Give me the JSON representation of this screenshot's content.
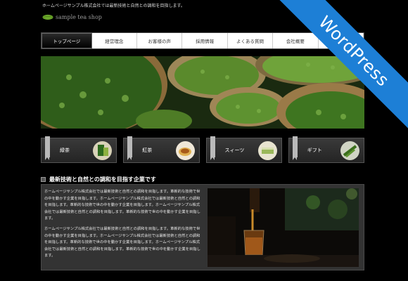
{
  "header": {
    "tagline": "ホームページサンプル株式会社では最新技術と自然との調和を目指します。",
    "logo_text": "sample tea shop"
  },
  "nav": {
    "items": [
      "トップページ",
      "経営理念",
      "お客様の声",
      "採用情報",
      "よくある質問",
      "会社概要",
      "お問"
    ],
    "active_index": 0
  },
  "categories": [
    {
      "label": "緑茶",
      "icon": "green-tea-product-icon"
    },
    {
      "label": "紅茶",
      "icon": "black-tea-cup-icon"
    },
    {
      "label": "スィーツ",
      "icon": "sweets-icon"
    },
    {
      "label": "ギフト",
      "icon": "gift-tea-leaves-icon"
    }
  ],
  "section": {
    "heading": "最新技術と自然との調和を目指す企業です",
    "paragraphs": [
      "ホームページサンプル株式会社では最新技術と自然との調和を目指します。革新的な技術で世の中を動かす企業を目指します。ホームページサンプル株式会社では最新技術と自然との調和を目指します。革新的な技術で世の中を動かす企業を目指します。ホームページサンプル株式会社では最新技術と自然との調和を目指します。革新的な技術で世の中を動かす企業を目指します。",
      "ホームページサンプル株式会社では最新技術と自然との調和を目指します。革新的な技術で世の中を動かす企業を目指します。ホームページサンプル株式会社では最新技術と自然との調和を目指します。革新的な技術で世の中を動かす企業を目指します。ホームページサンプル株式会社では最新技術と自然との調和を目指します。革新的な技術で世の中を動かす企業を目指します。"
    ]
  },
  "ribbon": {
    "label": "WordPress"
  },
  "colors": {
    "ribbon": "#1d7fd6",
    "background": "#000000",
    "content_panel": "#333333"
  }
}
